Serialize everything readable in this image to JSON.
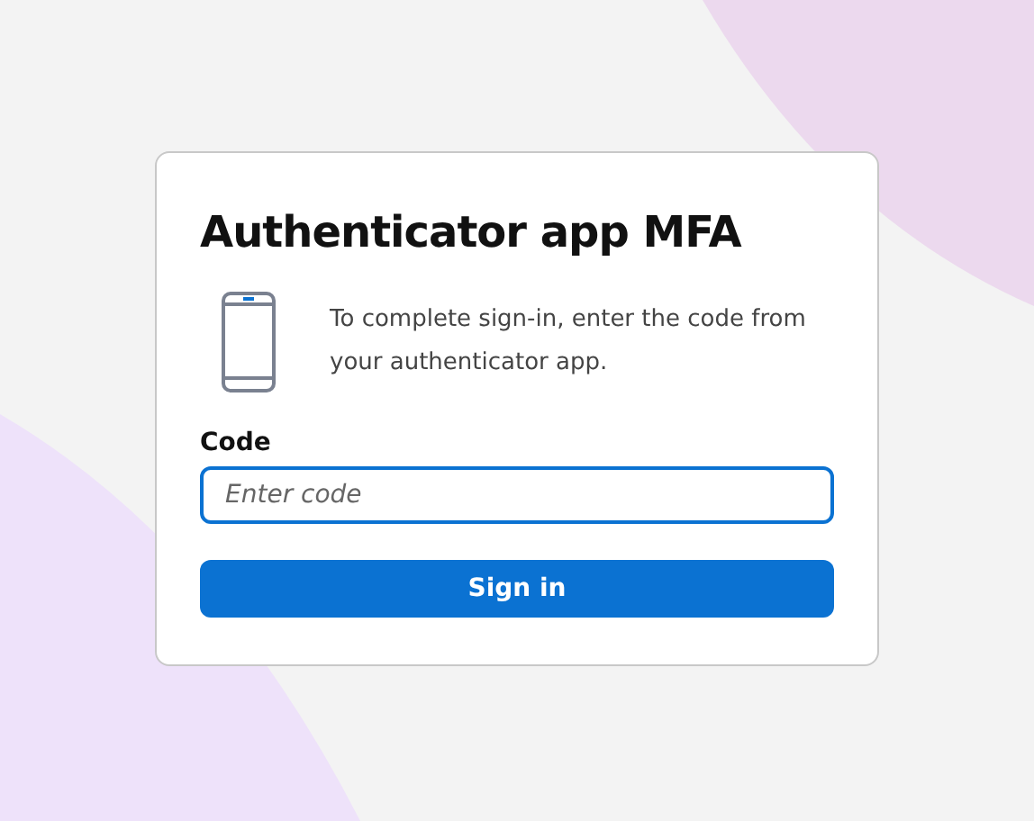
{
  "card": {
    "title": "Authenticator app MFA",
    "description": "To complete sign-in, enter the code from your authenticator app.",
    "field": {
      "label": "Code",
      "placeholder": "Enter code",
      "focused": true
    },
    "button": "Sign in"
  }
}
